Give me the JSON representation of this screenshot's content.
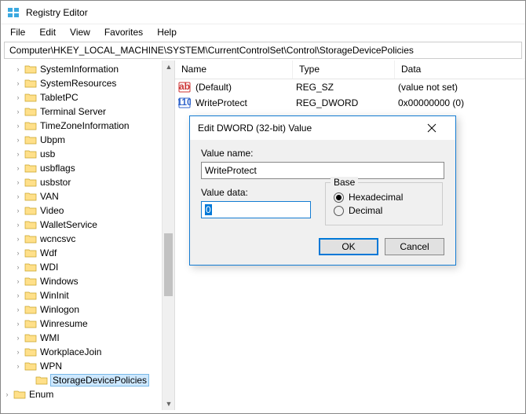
{
  "title": "Registry Editor",
  "menu": {
    "file": "File",
    "edit": "Edit",
    "view": "View",
    "favorites": "Favorites",
    "help": "Help"
  },
  "address": "Computer\\HKEY_LOCAL_MACHINE\\SYSTEM\\CurrentControlSet\\Control\\StorageDevicePolicies",
  "tree": {
    "items": [
      {
        "label": "SystemInformation"
      },
      {
        "label": "SystemResources"
      },
      {
        "label": "TabletPC"
      },
      {
        "label": "Terminal Server"
      },
      {
        "label": "TimeZoneInformation"
      },
      {
        "label": "Ubpm"
      },
      {
        "label": "usb"
      },
      {
        "label": "usbflags"
      },
      {
        "label": "usbstor"
      },
      {
        "label": "VAN"
      },
      {
        "label": "Video"
      },
      {
        "label": "WalletService"
      },
      {
        "label": "wcncsvc"
      },
      {
        "label": "Wdf"
      },
      {
        "label": "WDI"
      },
      {
        "label": "Windows"
      },
      {
        "label": "WinInit"
      },
      {
        "label": "Winlogon"
      },
      {
        "label": "Winresume"
      },
      {
        "label": "WMI"
      },
      {
        "label": "WorkplaceJoin"
      },
      {
        "label": "WPN"
      },
      {
        "label": "StorageDevicePolicies",
        "selected": true,
        "level": 1
      }
    ],
    "enum_label": "Enum"
  },
  "list": {
    "headers": {
      "name": "Name",
      "type": "Type",
      "data": "Data"
    },
    "rows": [
      {
        "icon": "ab",
        "name": "(Default)",
        "type": "REG_SZ",
        "data": "(value not set)"
      },
      {
        "icon": "bin",
        "name": "WriteProtect",
        "type": "REG_DWORD",
        "data": "0x00000000 (0)"
      }
    ]
  },
  "dialog": {
    "title": "Edit DWORD (32-bit) Value",
    "value_name_label": "Value name:",
    "value_name": "WriteProtect",
    "value_data_label": "Value data:",
    "value_data": "0",
    "base_label": "Base",
    "hex_label": "Hexadecimal",
    "dec_label": "Decimal",
    "ok": "OK",
    "cancel": "Cancel"
  }
}
